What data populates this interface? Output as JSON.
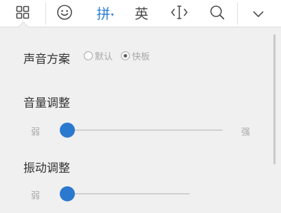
{
  "toolbar": {
    "items": [
      {
        "name": "grid-menu",
        "icon": "grid-icon"
      },
      {
        "name": "emoji",
        "icon": "smiley-icon"
      },
      {
        "name": "pinyin",
        "label": "拼",
        "caret": "▾",
        "color": "#2c7fd4"
      },
      {
        "name": "english",
        "label": "英"
      },
      {
        "name": "cursor-move",
        "icon": "text-cursor-icon"
      },
      {
        "name": "search",
        "icon": "search-icon"
      },
      {
        "name": "collapse",
        "icon": "chevron-down-icon"
      }
    ]
  },
  "panel": {
    "sound_scheme": {
      "title": "声音方案",
      "options": [
        {
          "label": "默认",
          "checked": false
        },
        {
          "label": "快板",
          "checked": true
        }
      ]
    },
    "volume": {
      "title": "音量调整",
      "min_label": "弱",
      "max_label": "强",
      "value": 0
    },
    "vibration": {
      "title": "振动调整",
      "min_label": "弱",
      "value": 0
    }
  },
  "colors": {
    "accent": "#2c7fd4",
    "panel_bg": "#f0f0f0",
    "muted_text": "#a8a8a8"
  }
}
